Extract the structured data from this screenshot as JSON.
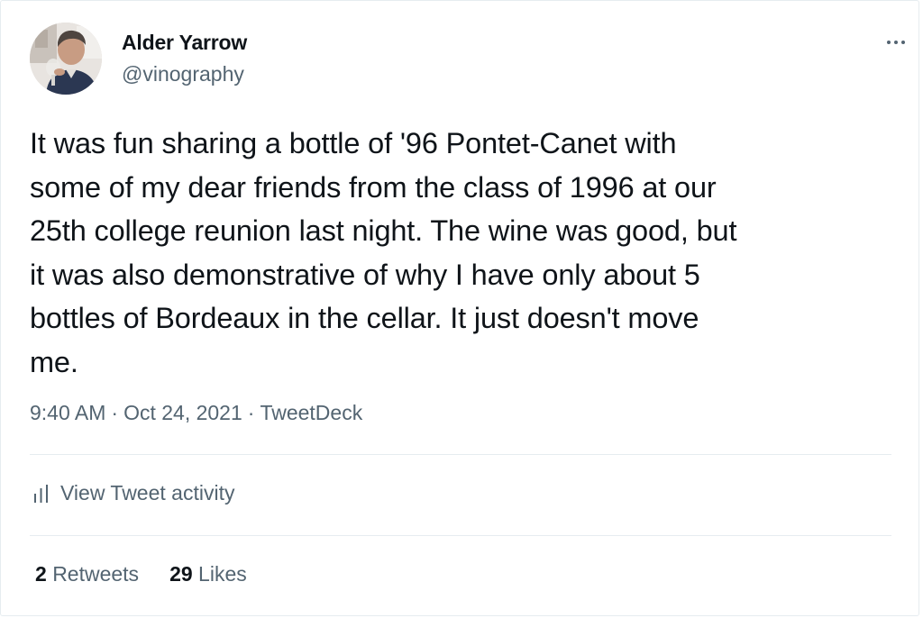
{
  "author": {
    "name": "Alder Yarrow",
    "handle": "@vinography",
    "avatar_icon": "profile-photo"
  },
  "tweet": {
    "text": "It was fun sharing a bottle of '96 Pontet-Canet with\nsome of my dear friends from the class of 1996 at our\n25th college reunion last night. The wine was good, but\nit was also demonstrative of why I have only about 5\nbottles of Bordeaux in the cellar. It just doesn't move\nme.",
    "time": "9:40 AM",
    "date": "Oct 24, 2021",
    "source": "TweetDeck",
    "separator": "·"
  },
  "actions": {
    "more_icon": "more-horizontal-icon",
    "activity_label": "View Tweet activity",
    "activity_icon": "bar-chart-icon"
  },
  "stats": {
    "retweets_count": "2",
    "retweets_label": "Retweets",
    "likes_count": "29",
    "likes_label": "Likes"
  },
  "colors": {
    "text_primary": "#0f1419",
    "text_secondary": "#536471",
    "border": "#e6ecf0"
  }
}
